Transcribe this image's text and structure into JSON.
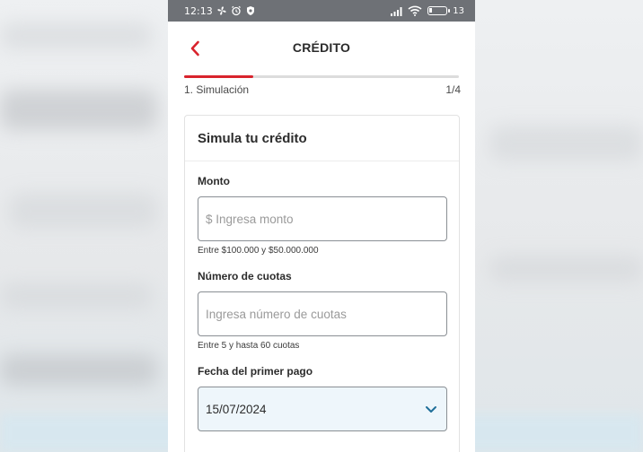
{
  "statusbar": {
    "time": "12:13",
    "battery_text": "13"
  },
  "appbar": {
    "title": "CRÉDITO"
  },
  "progress": {
    "step_label": "1. Simulación",
    "step_count": "1/4",
    "fraction": 0.25
  },
  "card": {
    "title": "Simula tu crédito",
    "monto": {
      "label": "Monto",
      "placeholder": "$ Ingresa monto",
      "value": "",
      "helper": "Entre $100.000 y $50.000.000"
    },
    "cuotas": {
      "label": "Número de cuotas",
      "placeholder": "Ingresa número de cuotas",
      "value": "",
      "helper": "Entre 5 y hasta 60 cuotas"
    },
    "fecha": {
      "label": "Fecha del primer pago",
      "value": "15/07/2024"
    }
  },
  "colors": {
    "accent": "#d9232d",
    "select_bg": "#eef6fb",
    "chevron": "#1f6f99"
  }
}
